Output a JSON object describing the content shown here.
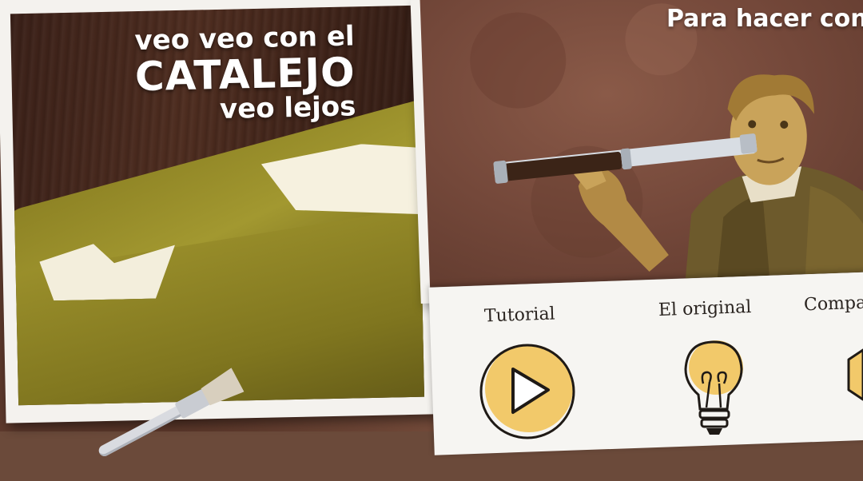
{
  "left_photo": {
    "title_line1": "veo veo con el",
    "title_line2": "CATALEJO",
    "title_line3": "veo lejos"
  },
  "right_photo": {
    "title": "Para hacer con"
  },
  "links": {
    "tutorial": "Tutorial",
    "original": "El original",
    "compartir": "Compa"
  },
  "colors": {
    "accent_yellow": "#f2c96a",
    "background": "#6b4a3a",
    "paper": "#f6f5f2"
  }
}
